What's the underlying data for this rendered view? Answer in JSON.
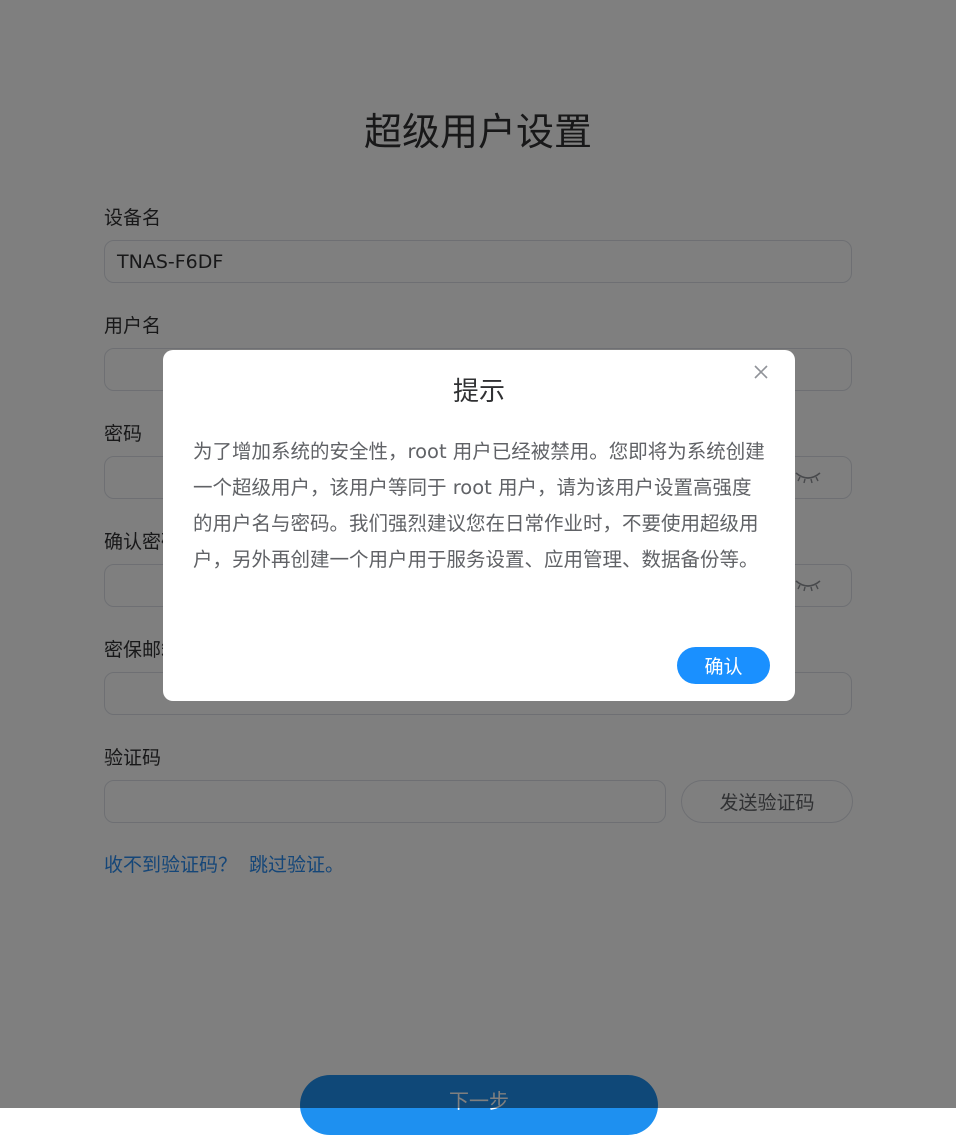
{
  "page": {
    "title": "超级用户设置",
    "next_label": "下一步"
  },
  "form": {
    "device_name": {
      "label": "设备名",
      "value": "TNAS-F6DF"
    },
    "username": {
      "label": "用户名",
      "value": ""
    },
    "password": {
      "label": "密码",
      "value": ""
    },
    "confirm_password": {
      "label": "确认密码",
      "value": ""
    },
    "security_email": {
      "label": "密保邮箱",
      "value": ""
    },
    "verification_code": {
      "label": "验证码",
      "value": "",
      "send_label": "发送验证码"
    }
  },
  "help": {
    "no_code": "收不到验证码？",
    "skip": "跳过验证。"
  },
  "dialog": {
    "title": "提示",
    "body": "为了增加系统的安全性，root 用户已经被禁用。您即将为系统创建一个超级用户，该用户等同于 root 用户，请为该用户设置高强度的用户名与密码。我们强烈建议您在日常作业时，不要使用超级用户，另外再创建一个用户用于服务设置、应用管理、数据备份等。",
    "confirm_label": "确认"
  },
  "colors": {
    "accent": "#1a90ff",
    "link": "#2a8df0",
    "overlay": "rgba(0,0,0,0.5)"
  },
  "icons": {
    "password_toggle": "eye-closed-icon",
    "dialog_close": "close-icon"
  }
}
